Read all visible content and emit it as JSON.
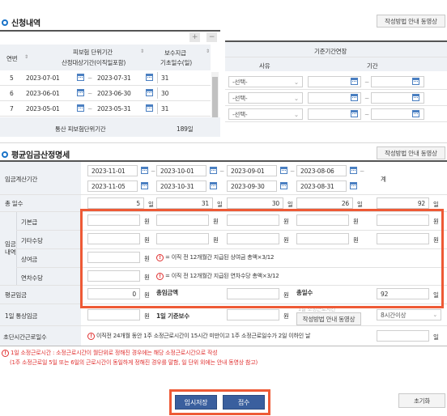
{
  "app": {
    "accent": "#1a73c8",
    "highlight": "#ee5a36"
  },
  "section1": {
    "title": "신청내역",
    "guide_btn": "작성방법 안내 동영상",
    "period_table": {
      "col_no": "연번",
      "col_period": "피보험 단위기간",
      "col_period_sub": "산정대상기간(이직일포함)",
      "col_days": "보수지급",
      "col_days_sub": "기초일수(일)",
      "plus": "+",
      "minus": "−",
      "rows": [
        {
          "no": "5",
          "from": "2023-07-01",
          "to": "2023-07-31",
          "days": "31"
        },
        {
          "no": "6",
          "from": "2023-06-01",
          "to": "2023-06-30",
          "days": "30"
        },
        {
          "no": "7",
          "from": "2023-05-01",
          "to": "2023-05-31",
          "days": "31"
        }
      ],
      "total_label": "통산 피보험단위기간",
      "total_value": "189일"
    },
    "ext_table": {
      "title": "기준기간연장",
      "col_reason": "사유",
      "col_period": "기간",
      "select_placeholder": "-선택-",
      "row_count": 3
    }
  },
  "section2": {
    "title": "평균임금산정명세",
    "guide_btn": "작성방법 안내 동영상",
    "calc_period_label": "임금계산기간",
    "total_col": "계",
    "periods": [
      {
        "from": "2023-11-01",
        "to": "2023-11-05"
      },
      {
        "from": "2023-10-01",
        "to": "2023-10-31"
      },
      {
        "from": "2023-09-01",
        "to": "2023-09-30"
      },
      {
        "from": "2023-08-06",
        "to": "2023-08-31"
      }
    ],
    "total_days_label": "총 일수",
    "days": [
      "5",
      "31",
      "30",
      "26"
    ],
    "days_total": "92",
    "unit_day": "일",
    "unit_won": "원",
    "wage_group_label": "임금\n내역",
    "wage_group_l1": "임금",
    "wage_group_l2": "내역",
    "rows": {
      "base": "기본급",
      "other": "기타수당",
      "bonus": "상여금",
      "annual": "연차수당"
    },
    "bonus_note": "= 이직 전 12개월간 지급된 상여금 총액×3/12",
    "annual_note": "= 이직 전 12개월간 지급된 연차수당 총액×3/12",
    "avg_wage_label": "평균임금",
    "avg_wage_value": "0",
    "total_wage_label": "총임금액",
    "total_days2_label": "총일수",
    "total_days2_value": "92",
    "normal_wage_label": "1일 통상임금",
    "base_pay_label": "1일 기준보수",
    "work_hours_hint": "1일 소정근로시간",
    "work_hours_value": "8시간이상",
    "guide_btn2": "작성방법 안내 동영상",
    "short_label": "초단시간근로일수",
    "short_note": "이직전 24개월 동안 1주 소정근로시간이 15시간 미만이고 1주 소정근로일수가 2일 이하인 날"
  },
  "footnote": {
    "line1": "1일 소정근로시간 : 소정근로시간이 월단위로 정해진 경우에는 해당 소정근로시간으로 작성",
    "line2": "(1주 소정근로일 5일 또는 6일의 근로시간이 동일하게 정해진 경우를 말함, 일 단위 외에는 안내 동영상 참고)"
  },
  "actions": {
    "save_temp": "임시저장",
    "submit": "접수",
    "reset": "초기화"
  }
}
